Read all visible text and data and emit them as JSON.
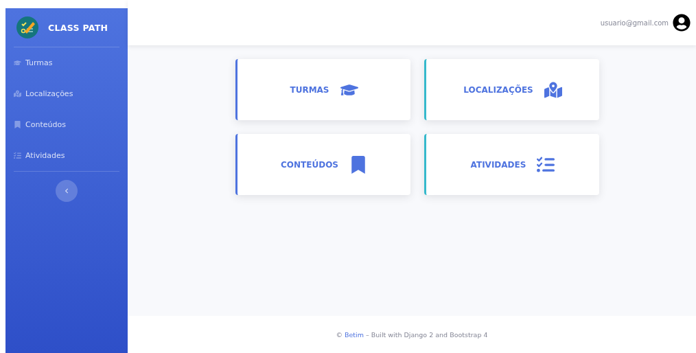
{
  "sidebar": {
    "brand": "CLASS PATH",
    "items": [
      {
        "label": "Turmas"
      },
      {
        "label": "Localizações"
      },
      {
        "label": "Conteúdos"
      },
      {
        "label": "Atividades"
      }
    ]
  },
  "topbar": {
    "user": "usuario@gmail.com"
  },
  "cards": [
    {
      "title": "TURMAS",
      "color": "#4e73df"
    },
    {
      "title": "LOCALIZAÇÕES",
      "color": "#36b9cc"
    },
    {
      "title": "CONTEÚDOS",
      "color": "#4e73df"
    },
    {
      "title": "ATIVIDADES",
      "color": "#36b9cc"
    }
  ],
  "footer": {
    "prefix": "©",
    "link": "Betim",
    "text": "– Built with Django 2 and Bootstrap 4"
  }
}
